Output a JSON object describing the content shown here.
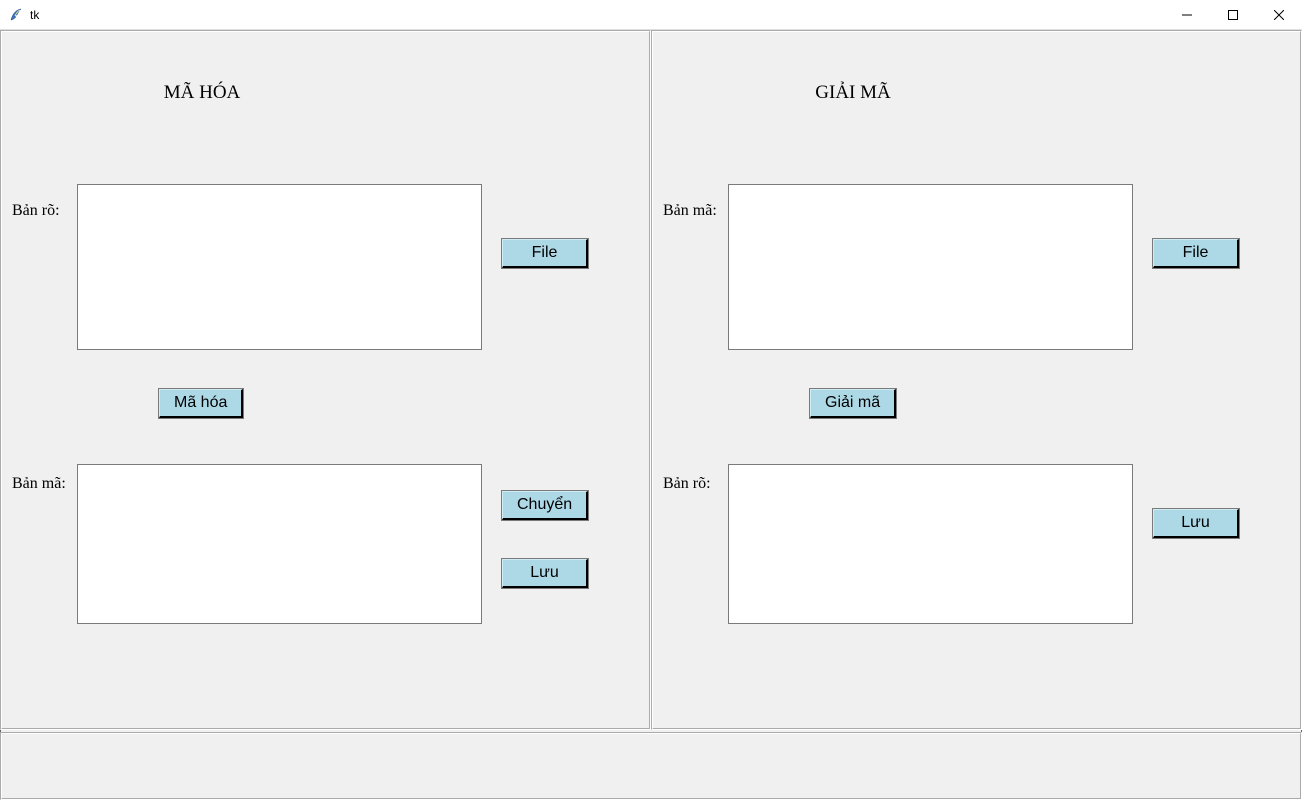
{
  "window": {
    "title": "tk"
  },
  "encode": {
    "heading": "MÃ HÓA",
    "input_label": "Bản rõ:",
    "output_label": "Bản mã:",
    "input_value": "",
    "output_value": "",
    "buttons": {
      "file": "File",
      "encode": "Mã hóa",
      "transfer": "Chuyển",
      "save": "Lưu"
    }
  },
  "decode": {
    "heading": "GIẢI MÃ",
    "input_label": "Bản mã:",
    "output_label": "Bản rõ:",
    "input_value": "",
    "output_value": "",
    "buttons": {
      "file": "File",
      "decode": "Giải mã",
      "save": "Lưu"
    }
  }
}
